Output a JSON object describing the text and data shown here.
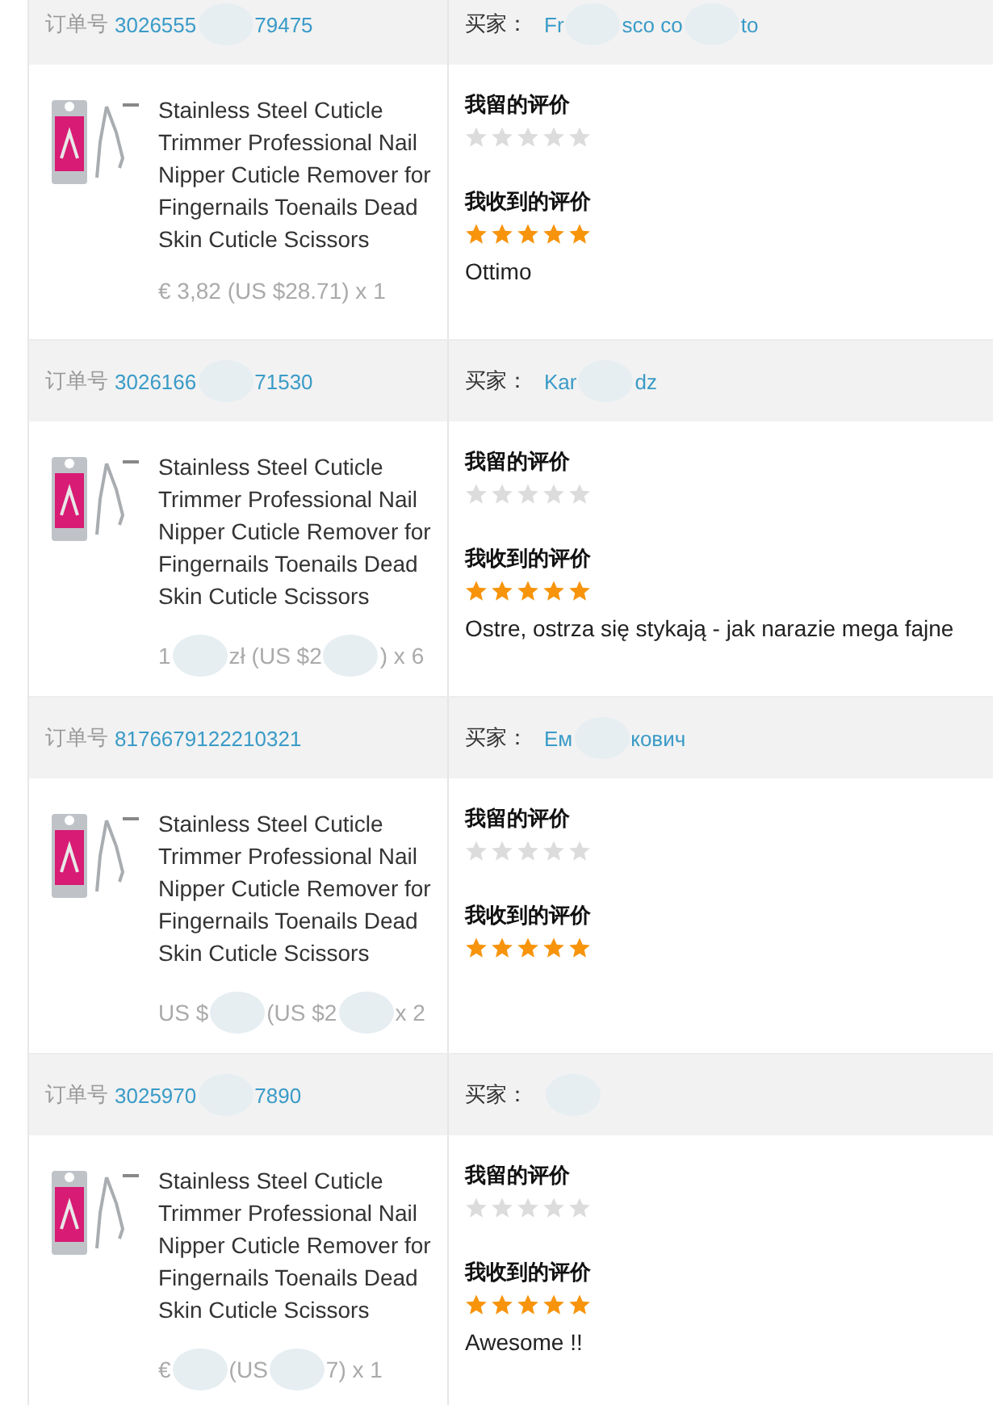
{
  "orders": [
    {
      "order_label": "订单号",
      "order_number_parts": [
        "3026555",
        "79475"
      ],
      "buyer_label": "买家：",
      "buyer_parts": [
        "Fr",
        "sco co",
        "to"
      ],
      "product_title": "Stainless Steel Cuticle Trimmer Professional Nail Nipper Cuticle Remover for Fingernails Toenails Dead Skin Cuticle Scissors",
      "price_parts": [
        "€ 3,82 (US $28.71) x 1"
      ],
      "my_review": {
        "label": "我留的评价",
        "stars": 0
      },
      "received_review": {
        "label": "我收到的评价",
        "stars": 5,
        "comment": "Ottimo"
      }
    },
    {
      "order_label": "订单号",
      "order_number_parts": [
        "3026166",
        "71530"
      ],
      "buyer_label": "买家：",
      "buyer_parts": [
        "Kar",
        "dz"
      ],
      "product_title": "Stainless Steel Cuticle Trimmer Professional Nail Nipper Cuticle Remover for Fingernails Toenails Dead Skin Cuticle Scissors",
      "price_parts": [
        "1",
        "zł (US $2",
        ") x 6"
      ],
      "my_review": {
        "label": "我留的评价",
        "stars": 0
      },
      "received_review": {
        "label": "我收到的评价",
        "stars": 5,
        "comment": "Ostre, ostrza się stykają - jak narazie mega fajne"
      }
    },
    {
      "order_label": "订单号",
      "order_number_parts": [
        "8176679122210321"
      ],
      "buyer_label": "买家：",
      "buyer_parts": [
        "Ем",
        "кович"
      ],
      "product_title": "Stainless Steel Cuticle Trimmer Professional Nail Nipper Cuticle Remover for Fingernails Toenails Dead Skin Cuticle Scissors",
      "price_parts": [
        "US $",
        "(US $2",
        " x 2"
      ],
      "my_review": {
        "label": "我留的评价",
        "stars": 0
      },
      "received_review": {
        "label": "我收到的评价",
        "stars": 5
      }
    },
    {
      "order_label": "订单号",
      "order_number_parts": [
        "3025970",
        "7890"
      ],
      "buyer_label": "买家：",
      "product_title": "Stainless Steel Cuticle Trimmer Professional Nail Nipper Cuticle Remover for Fingernails Toenails Dead Skin Cuticle Scissors",
      "price_parts": [
        "€",
        "(US",
        "7) x 1"
      ],
      "my_review": {
        "label": "我留的评价",
        "stars": 0
      },
      "received_review": {
        "label": "我收到的评价",
        "stars": 5,
        "comment": "Awesome !!"
      }
    }
  ]
}
